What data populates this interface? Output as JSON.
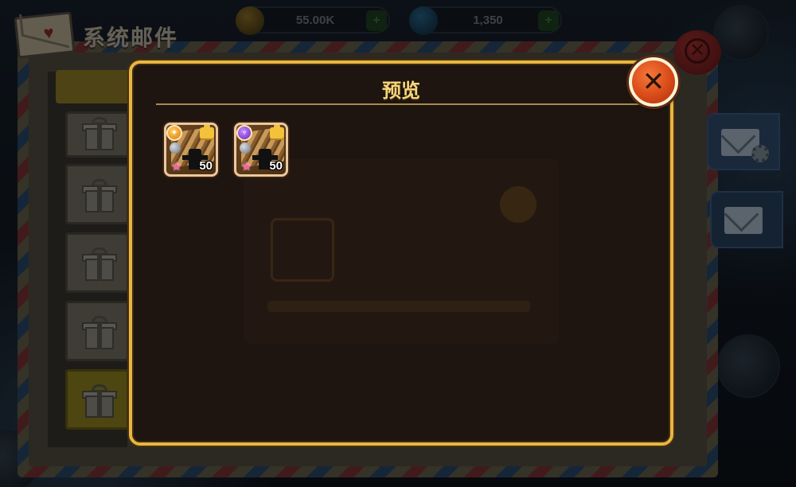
{
  "hud": {
    "gold_value": "55.00K",
    "gem_value": "1,350",
    "plus_label": "+"
  },
  "mail_window": {
    "title": "系统邮件"
  },
  "dialog": {
    "title": "预览",
    "close_label": "✕",
    "items": [
      {
        "element": "fire",
        "element_icon": "fire-element-icon",
        "count": "50",
        "star": "★"
      },
      {
        "element": "arcane",
        "element_icon": "arcane-element-icon",
        "count": "50",
        "star": "★"
      }
    ]
  },
  "colors": {
    "dialog_border": "#e7b740",
    "dialog_bg": "#1e1510",
    "title_text": "#f8d77a",
    "close_button": "#d84a18"
  }
}
